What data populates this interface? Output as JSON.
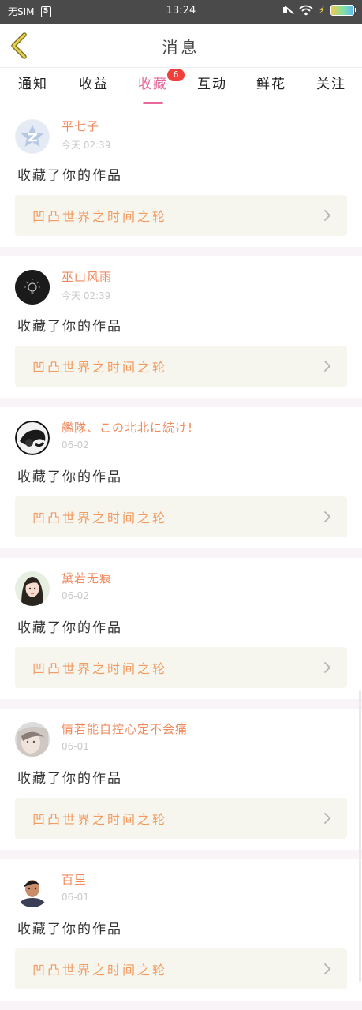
{
  "status_bar": {
    "carrier": "无SIM",
    "sim_icon": "S",
    "time": "13:24",
    "icons": [
      "mute-icon",
      "wifi-icon",
      "charging-icon",
      "battery-icon"
    ]
  },
  "header": {
    "title": "消息",
    "back_icon": "chevron-left-icon"
  },
  "tabs": [
    {
      "label": "通知",
      "active": false
    },
    {
      "label": "收益",
      "active": false
    },
    {
      "label": "收藏",
      "active": true,
      "badge": "6"
    },
    {
      "label": "互动",
      "active": false
    },
    {
      "label": "鲜花",
      "active": false
    },
    {
      "label": "关注",
      "active": false
    }
  ],
  "colors": {
    "accent": "#e86a9a",
    "username": "#f08a5d",
    "work_title": "#f39a5e",
    "badge": "#f0403c",
    "status_bar": "#4a4a4a"
  },
  "notifications": [
    {
      "username": "平七子",
      "time": "今天 02:39",
      "action": "收藏了你的作品",
      "work": "凹凸世界之时间之轮"
    },
    {
      "username": "巫山风雨",
      "time": "今天 02:39",
      "action": "收藏了你的作品",
      "work": "凹凸世界之时间之轮"
    },
    {
      "username": "艦隊、この北北に続け!",
      "time": "06-02",
      "action": "收藏了你的作品",
      "work": "凹凸世界之时间之轮"
    },
    {
      "username": "黛若无痕",
      "time": "06-02",
      "action": "收藏了你的作品",
      "work": "凹凸世界之时间之轮"
    },
    {
      "username": "情若能自控心定不会痛",
      "time": "06-01",
      "action": "收藏了你的作品",
      "work": "凹凸世界之时间之轮"
    },
    {
      "username": "百里",
      "time": "06-01",
      "action": "收藏了你的作品",
      "work": "凹凸世界之时间之轮"
    }
  ]
}
